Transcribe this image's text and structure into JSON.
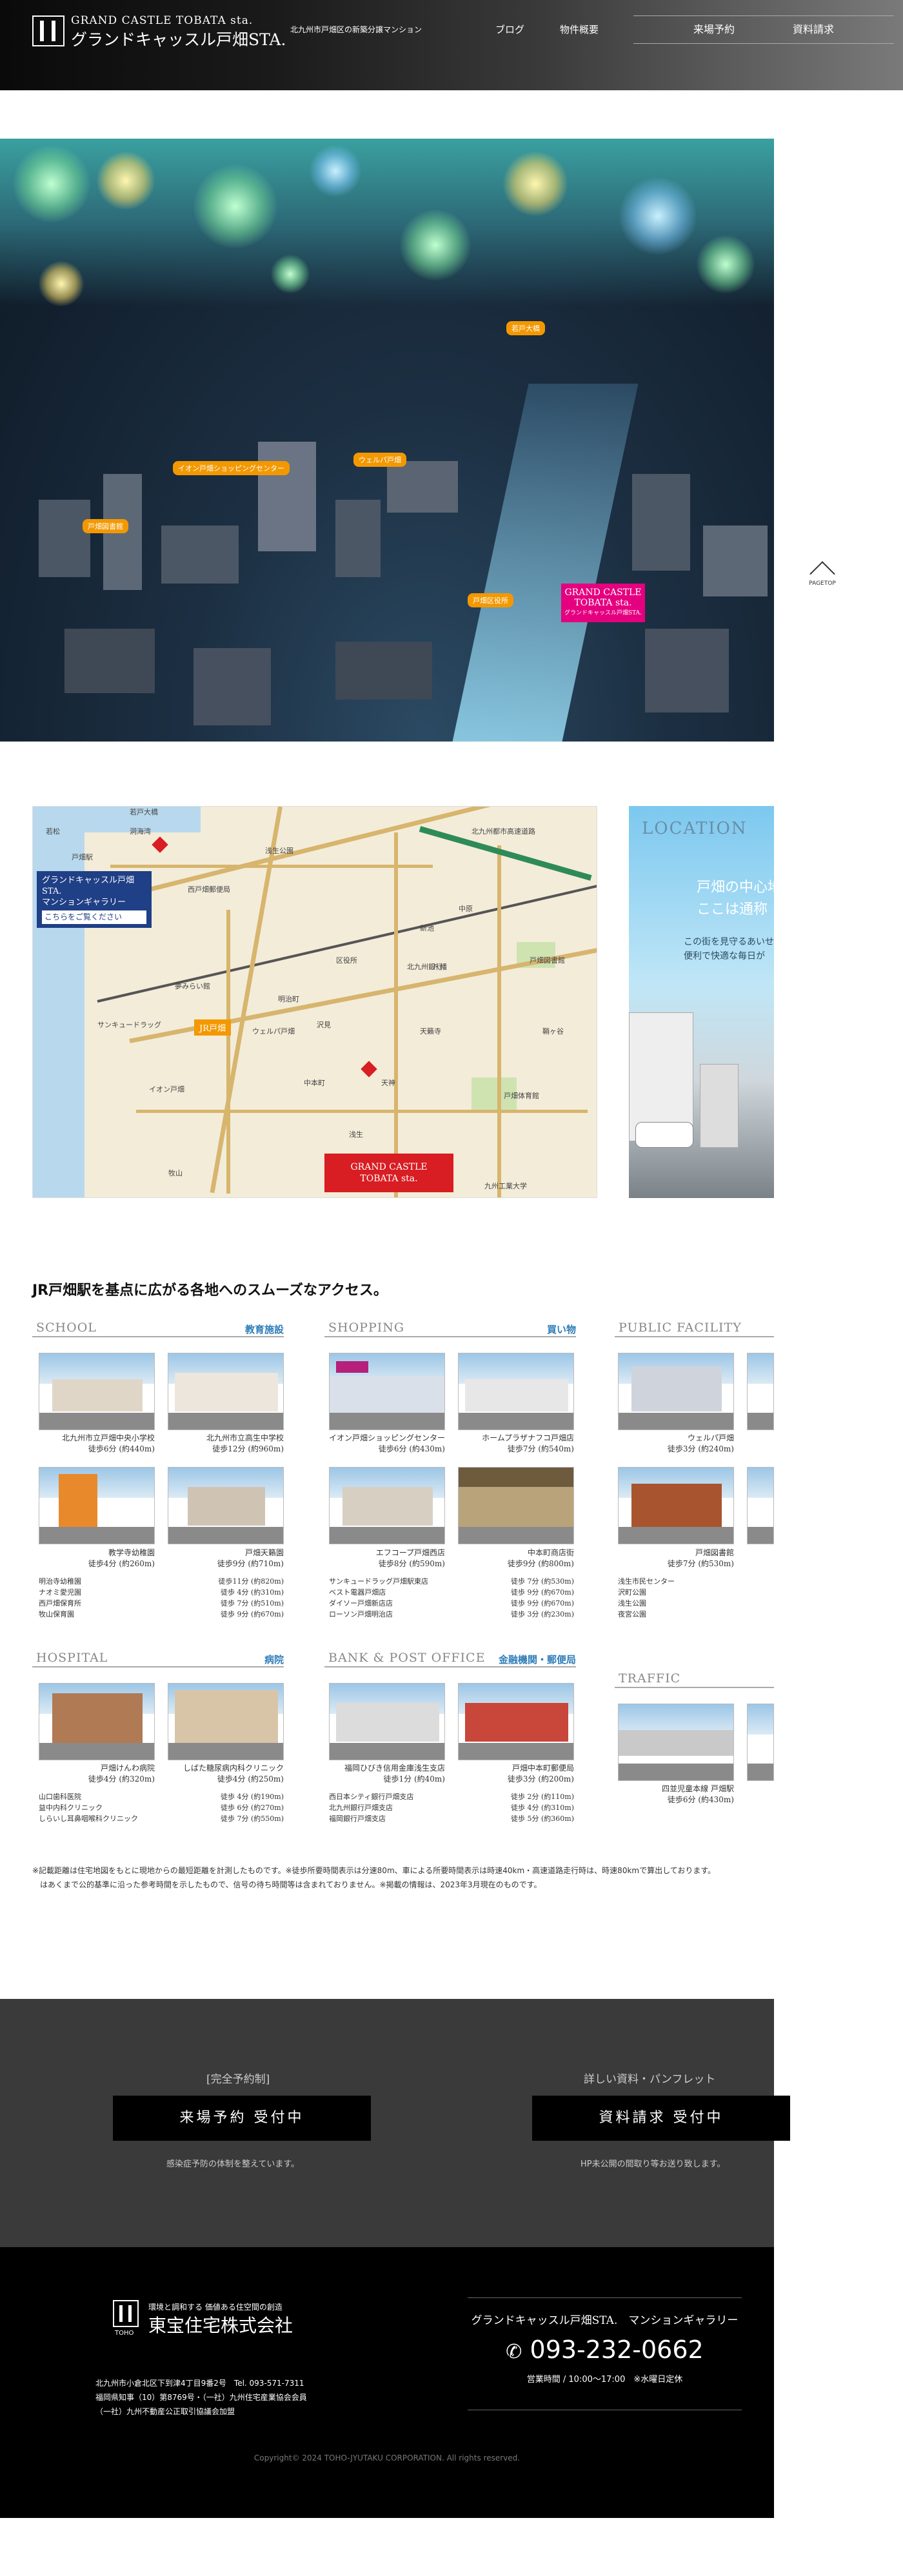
{
  "header": {
    "logo_en": "GRAND CASTLE TOBATA sta.",
    "logo_jp": "グランドキャッスル戸畑STA.",
    "tagline": "北九州市戸畑区の新築分譲マンション",
    "nav": [
      "ブログ",
      "物件概要"
    ],
    "btn_visit": "来場予約",
    "btn_request": "資料請求"
  },
  "hero": {
    "labels": [
      "若戸大橋",
      "イオン戸畑ショッピングセンター",
      "ウェルパ戸畑",
      "戸畑図書館",
      "戸畑区役所"
    ],
    "pin": [
      "GRAND CASTLE",
      "TOBATA sta.",
      "グランドキャッスル戸畑STA."
    ]
  },
  "pagetop": {
    "label": "PAGETOP"
  },
  "map": {
    "gallery": [
      "グランドキャッスル戸畑STA.",
      "マンションギャラリー"
    ],
    "gallery_link": "こちらをご覧ください",
    "station": "JR戸畑",
    "pin_line1": "GRAND CASTLE",
    "pin_line2": "TOBATA sta.",
    "labels": [
      "若戸大橋",
      "戸畑駅",
      "若松",
      "洞海湾",
      "西戸畑郵便局",
      "浅生公園",
      "北九州都市高速道路",
      "八幡",
      "区役所",
      "明治町",
      "牧山",
      "沢見",
      "中本町",
      "天籟寺",
      "鞘ヶ谷",
      "新池",
      "戸畑図書館",
      "天神",
      "浅生",
      "サンキュードラッグ",
      "イオン戸畑",
      "中原",
      "北九州銀行",
      "ウェルパ戸畑",
      "戸畑体育館",
      "夢みらい館",
      "九州工業大学"
    ]
  },
  "location": {
    "badge": "LOCATION",
    "heading": [
      "戸畑の中心地。",
      "ここは通称「浅生」。"
    ],
    "body": [
      "この街を見守るあいせ、",
      "便利で快適な毎日が"
    ]
  },
  "access": {
    "title": "JR戸畑駅を基点に広がる各地へのスムーズなアクセス。",
    "school": {
      "en": "SCHOOL",
      "jp": "教育施設",
      "photos": [
        {
          "name": "北九州市立戸畑中央小学校",
          "dist": "徒歩6分 (約440m)"
        },
        {
          "name": "北九州市立高生中学校",
          "dist": "徒歩12分 (約960m)"
        },
        {
          "name": "教学寺幼稚園",
          "dist": "徒歩4分 (約260m)"
        },
        {
          "name": "戸畑天籟園",
          "dist": "徒歩9分 (約710m)"
        }
      ],
      "list": [
        {
          "name": "明治寺幼稚園",
          "dist": "徒歩11分 (約820m)"
        },
        {
          "name": "ナオミ愛児園",
          "dist": "徒歩 4分 (約310m)"
        },
        {
          "name": "西戸畑保育所",
          "dist": "徒歩 7分 (約510m)"
        },
        {
          "name": "牧山保育園",
          "dist": "徒歩 9分 (約670m)"
        }
      ]
    },
    "shopping": {
      "en": "SHOPPING",
      "jp": "買い物",
      "photos": [
        {
          "name": "イオン戸畑ショッピングセンター",
          "dist": "徒歩6分 (約430m)"
        },
        {
          "name": "ホームプラザナフコ戸畑店",
          "dist": "徒歩7分 (約540m)"
        },
        {
          "name": "エフコープ戸畑西店",
          "dist": "徒歩8分 (約590m)"
        },
        {
          "name": "中本町商店街",
          "dist": "徒歩9分 (約800m)"
        }
      ],
      "list": [
        {
          "name": "サンキュードラッグ戸畑駅東店",
          "dist": "徒歩 7分 (約530m)"
        },
        {
          "name": "ベスト電器戸畑店",
          "dist": "徒歩 9分 (約670m)"
        },
        {
          "name": "ダイソー戸畑新店店",
          "dist": "徒歩 9分 (約670m)"
        },
        {
          "name": "ローソン戸畑明治店",
          "dist": "徒歩 3分 (約230m)"
        }
      ]
    },
    "public": {
      "en": "PUBLIC FACILITY",
      "jp": "",
      "photos": [
        {
          "name": "ウェルパ戸畑",
          "dist": "徒歩3分 (約240m)"
        },
        {
          "name": "戸畑図書館",
          "dist": "徒歩7分 (約530m)"
        }
      ],
      "list": [
        {
          "name": "浅生市民センター",
          "dist": ""
        },
        {
          "name": "沢町公園",
          "dist": ""
        },
        {
          "name": "浅生公園",
          "dist": ""
        },
        {
          "name": "夜宮公園",
          "dist": ""
        }
      ]
    },
    "hospital": {
      "en": "HOSPITAL",
      "jp": "病院",
      "photos": [
        {
          "name": "戸畑けんわ病院",
          "dist": "徒歩4分 (約320m)"
        },
        {
          "name": "しばた糖尿病内科クリニック",
          "dist": "徒歩4分 (約250m)"
        }
      ],
      "list": [
        {
          "name": "山口歯科医院",
          "dist": "徒歩 4分 (約190m)"
        },
        {
          "name": "益中内科クリニック",
          "dist": "徒歩 6分 (約270m)"
        },
        {
          "name": "しらいし耳鼻咽喉科クリニック",
          "dist": "徒歩 7分 (約550m)"
        }
      ]
    },
    "bank": {
      "en": "BANK & POST OFFICE",
      "jp": "金融機関・郵便局",
      "photos": [
        {
          "name": "福岡ひびき信用金庫浅生支店",
          "dist": "徒歩1分 (約40m)"
        },
        {
          "name": "戸畑中本町郵便局",
          "dist": "徒歩3分 (約200m)"
        }
      ],
      "list": [
        {
          "name": "西日本シティ銀行戸畑支店",
          "dist": "徒歩 2分 (約110m)"
        },
        {
          "name": "北九州銀行戸畑支店",
          "dist": "徒歩 4分 (約310m)"
        },
        {
          "name": "福岡銀行戸畑支店",
          "dist": "徒歩 5分 (約360m)"
        }
      ]
    },
    "traffic": {
      "en": "TRAFFIC",
      "jp": "",
      "photos": [
        {
          "name": "四並児童本線 戸畑駅",
          "dist": "徒歩6分 (約430m)"
        }
      ]
    }
  },
  "note": [
    "※記載距離は住宅地図をもとに現地からの最短距離を計測したものです。※徒歩所要時間表示は分速80m、車による所要時間表示は時速40km・高速道路走行時は、時速80kmで算出しております。",
    "　はあくまで公的基準に沿った参考時間を示したもので、信号の待ち時間等は含まれておりません。※掲載の情報は、2023年3月現在のものです。"
  ],
  "cta": {
    "left_pre": "[完全予約制]",
    "left_btn": "来場予約 受付中",
    "left_sub": "感染症予防の体制を整えています。",
    "right_pre": "詳しい資料・パンフレット",
    "right_btn": "資料請求 受付中",
    "right_sub": "HP未公開の間取り等お送り致します。"
  },
  "footer": {
    "logo_text": "TOHO",
    "tagline": "環境と調和する 価値ある住空間の創造",
    "company": "東宝住宅株式会社",
    "address": [
      "北九州市小倉北区下到津4丁目9番2号　Tel. 093-571-7311",
      "福岡県知事（10）第8769号・（一社）九州住宅産業協会会員",
      "（一社）九州不動産公正取引協議会加盟"
    ],
    "gallery_name": "グランドキャッスル戸畑STA.　マンションギャラリー",
    "tel": "093-232-0662",
    "hours": "営業時間 / 10:00～17:00　※水曜日定休",
    "copyright": "Copyright© 2024 TOHO-JYUTAKU CORPORATION. All rights reserved."
  }
}
